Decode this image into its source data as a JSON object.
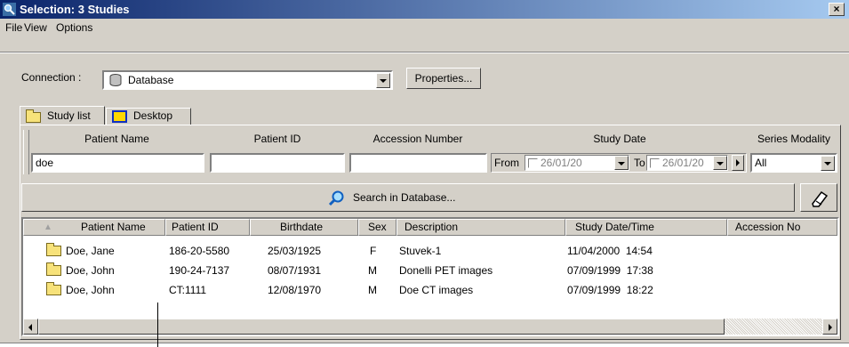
{
  "window": {
    "title": "Selection: 3 Studies",
    "close": "×"
  },
  "menu": {
    "file": "File",
    "view": "View",
    "options": "Options"
  },
  "connection": {
    "label": "Connection :",
    "value": "Database",
    "properties_button": "Properties..."
  },
  "tabs": [
    {
      "label": "Study list"
    },
    {
      "label": "Desktop"
    }
  ],
  "filters": {
    "patient_name": {
      "label": "Patient Name",
      "value": "doe"
    },
    "patient_id": {
      "label": "Patient ID",
      "value": ""
    },
    "accession": {
      "label": "Accession Number",
      "value": ""
    },
    "study_date": {
      "label": "Study Date",
      "from_label": "From",
      "from_value": "26/01/20",
      "to_label": "To",
      "to_value": "26/01/20"
    },
    "modality": {
      "label": "Series Modality",
      "value": "All"
    }
  },
  "search_button": "Search in Database...",
  "table": {
    "headers": [
      "Patient Name",
      "Patient ID",
      "Birthdate",
      "Sex",
      "Description",
      "Study Date/Time",
      "Accession No"
    ],
    "rows": [
      {
        "name": "Doe, Jane",
        "id": "186-20-5580",
        "birthdate": "25/03/1925",
        "sex": "F",
        "description": "Stuvek-1",
        "study": "11/04/2000  14:54",
        "accession": ""
      },
      {
        "name": "Doe, John",
        "id": "190-24-7137",
        "birthdate": "08/07/1931",
        "sex": "M",
        "description": "Donelli PET images",
        "study": "07/09/1999  17:38",
        "accession": ""
      },
      {
        "name": "Doe, John",
        "id": "CT:1111",
        "birthdate": "12/08/1970",
        "sex": "M",
        "description": "Doe CT images",
        "study": "07/09/1999  18:22",
        "accession": ""
      }
    ]
  }
}
